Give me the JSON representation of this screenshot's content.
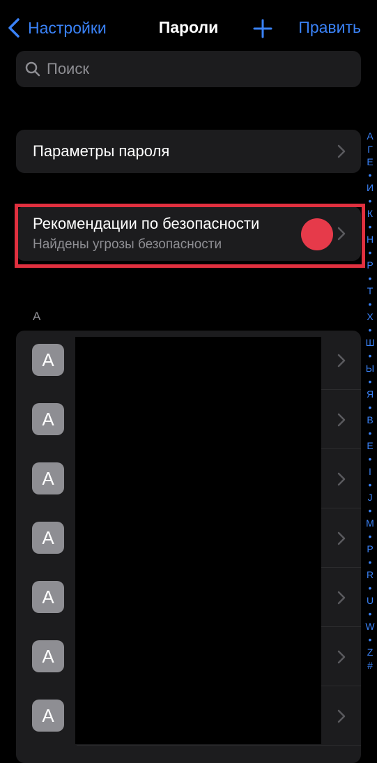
{
  "nav": {
    "back_label": "Настройки",
    "title": "Пароли",
    "edit_label": "Править",
    "add_icon": "plus-icon"
  },
  "search": {
    "placeholder": "Поиск",
    "icon": "search-icon"
  },
  "password_options": {
    "label": "Параметры пароля"
  },
  "security": {
    "title": "Рекомендации по безопасности",
    "subtitle": "Найдены угрозы безопасности"
  },
  "list": {
    "section_header": "A",
    "items": [
      {
        "avatar_letter": "A"
      },
      {
        "avatar_letter": "A"
      },
      {
        "avatar_letter": "A"
      },
      {
        "avatar_letter": "A"
      },
      {
        "avatar_letter": "A"
      },
      {
        "avatar_letter": "A"
      },
      {
        "avatar_letter": "A"
      }
    ]
  },
  "index": [
    "A",
    "Г",
    "Е",
    "•",
    "И",
    "•",
    "К",
    "•",
    "Н",
    "•",
    "Р",
    "•",
    "Т",
    "•",
    "Х",
    "•",
    "Ш",
    "•",
    "Ы",
    "•",
    "Я",
    "•",
    "B",
    "•",
    "E",
    "•",
    "I",
    "•",
    "J",
    "•",
    "M",
    "•",
    "P",
    "•",
    "R",
    "•",
    "U",
    "•",
    "W",
    "•",
    "Z",
    "#"
  ],
  "colors": {
    "accent": "#3a82f7",
    "background": "#000000",
    "cell": "#1c1c1e",
    "secondary_text": "#8e8e93",
    "highlight": "#e0303f",
    "dot": "#e63a4a"
  }
}
